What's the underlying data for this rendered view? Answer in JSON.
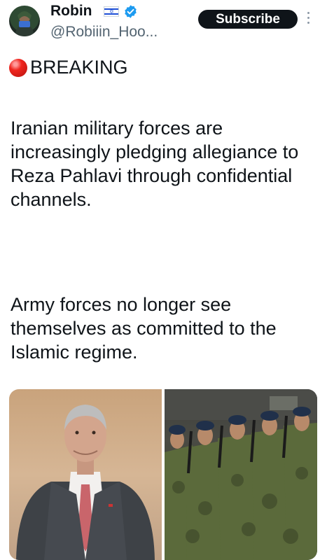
{
  "post": {
    "author_name": "Robin",
    "author_handle": "@Robiiin_Hoo...",
    "subscribe_label": "Subscribe",
    "breaking_label": "BREAKING",
    "paragraph_1": "Iranian military forces are increasingly pledging allegiance to Reza Pahlavi through confidential channels.",
    "paragraph_2": "Army forces no longer see themselves as committed to the Islamic regime.",
    "icons": {
      "flag": "israel-flag-icon",
      "verified": "verified-badge-icon",
      "more": "more-options-icon",
      "breaking": "red-circle-icon"
    }
  },
  "colors": {
    "text": "#0f1419",
    "secondary_text": "#536471",
    "subscribe_bg": "#0f1419",
    "verified_blue": "#1d9bf0",
    "breaking_red": "#e0201a"
  }
}
